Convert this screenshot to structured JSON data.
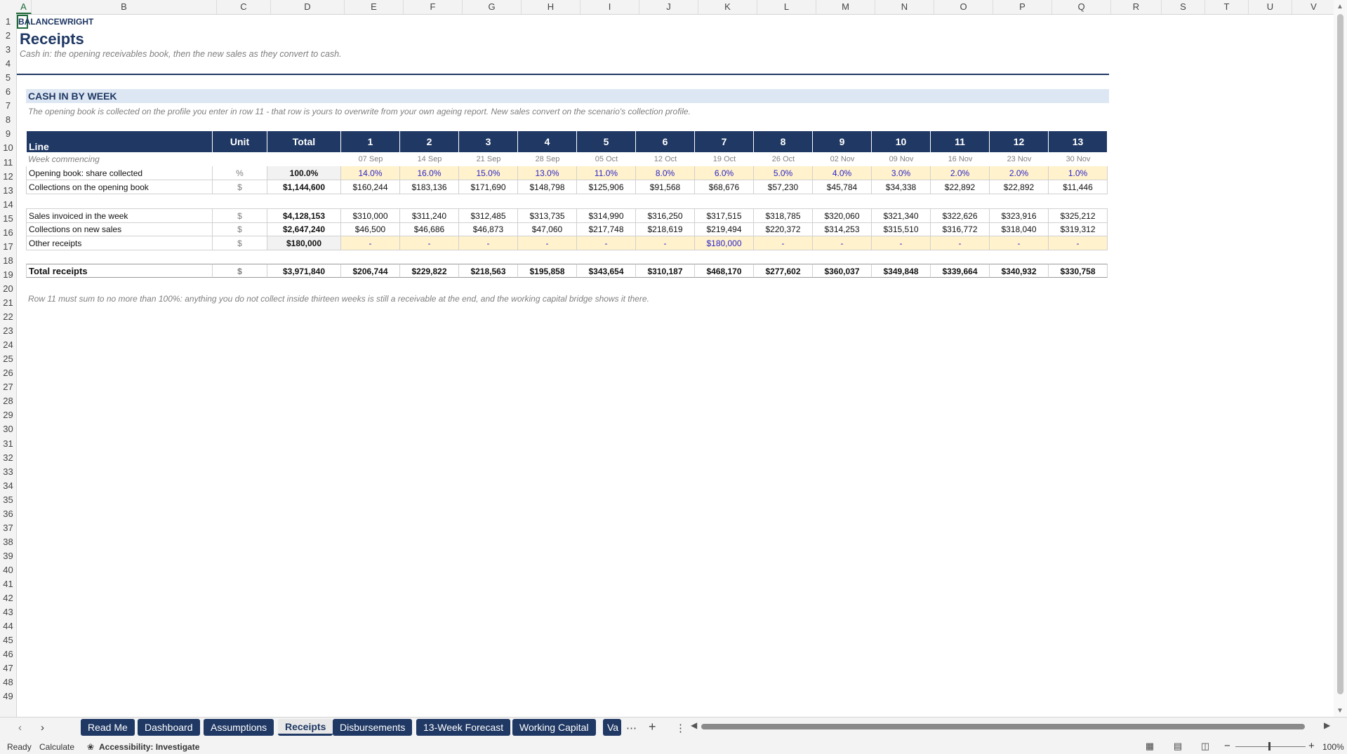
{
  "columns": [
    "A",
    "B",
    "C",
    "D",
    "E",
    "F",
    "G",
    "H",
    "I",
    "J",
    "K",
    "L",
    "M",
    "N",
    "O",
    "P",
    "Q",
    "R",
    "S",
    "T",
    "U",
    "V"
  ],
  "rows": [
    "1",
    "2",
    "3",
    "4",
    "5",
    "6",
    "7",
    "8",
    "9",
    "10",
    "11",
    "12",
    "13",
    "14",
    "15",
    "16",
    "17",
    "18",
    "19",
    "20",
    "21",
    "22",
    "23",
    "24",
    "25",
    "26",
    "27",
    "28",
    "29",
    "30",
    "31",
    "32",
    "33",
    "34",
    "35",
    "36",
    "37",
    "38",
    "39",
    "40",
    "41",
    "42",
    "43",
    "44",
    "45",
    "46",
    "47",
    "48",
    "49"
  ],
  "brand": "BALANCEWRIGHT",
  "title": "Receipts",
  "subtitle": "Cash in: the opening receivables book, then the new sales as they convert to cash.",
  "section_title": "CASH IN BY WEEK",
  "note": "The opening book is collected on the profile you enter in row 11 - that row is yours to overwrite from your own ageing report. New sales convert on the scenario's collection profile.",
  "table": {
    "header": {
      "line": "Line",
      "unit": "Unit",
      "total": "Total",
      "weeks": [
        "1",
        "2",
        "3",
        "4",
        "5",
        "6",
        "7",
        "8",
        "9",
        "10",
        "11",
        "12",
        "13"
      ]
    },
    "week_commencing": {
      "label": "Week commencing",
      "dates": [
        "07 Sep",
        "14 Sep",
        "21 Sep",
        "28 Sep",
        "05 Oct",
        "12 Oct",
        "19 Oct",
        "26 Oct",
        "02 Nov",
        "09 Nov",
        "16 Nov",
        "23 Nov",
        "30 Nov"
      ]
    },
    "opening_share": {
      "label": "Opening book: share collected",
      "unit": "%",
      "total": "100.0%",
      "values": [
        "14.0%",
        "16.0%",
        "15.0%",
        "13.0%",
        "11.0%",
        "8.0%",
        "6.0%",
        "5.0%",
        "4.0%",
        "3.0%",
        "2.0%",
        "2.0%",
        "1.0%"
      ]
    },
    "opening_collections": {
      "label": "Collections on the opening book",
      "unit": "$",
      "total": "$1,144,600",
      "values": [
        "$160,244",
        "$183,136",
        "$171,690",
        "$148,798",
        "$125,906",
        "$91,568",
        "$68,676",
        "$57,230",
        "$45,784",
        "$34,338",
        "$22,892",
        "$22,892",
        "$11,446"
      ]
    },
    "sales_invoiced": {
      "label": "Sales invoiced in the week",
      "unit": "$",
      "total": "$4,128,153",
      "values": [
        "$310,000",
        "$311,240",
        "$312,485",
        "$313,735",
        "$314,990",
        "$316,250",
        "$317,515",
        "$318,785",
        "$320,060",
        "$321,340",
        "$322,626",
        "$323,916",
        "$325,212"
      ]
    },
    "new_collections": {
      "label": "Collections on new sales",
      "unit": "$",
      "total": "$2,647,240",
      "values": [
        "$46,500",
        "$46,686",
        "$46,873",
        "$47,060",
        "$217,748",
        "$218,619",
        "$219,494",
        "$220,372",
        "$314,253",
        "$315,510",
        "$316,772",
        "$318,040",
        "$319,312"
      ]
    },
    "other_receipts": {
      "label": "Other receipts",
      "unit": "$",
      "total": "$180,000",
      "values": [
        "-",
        "-",
        "-",
        "-",
        "-",
        "-",
        "$180,000",
        "-",
        "-",
        "-",
        "-",
        "-",
        "-"
      ]
    },
    "total_receipts": {
      "label": "Total receipts",
      "unit": "$",
      "total": "$3,971,840",
      "values": [
        "$206,744",
        "$229,822",
        "$218,563",
        "$195,858",
        "$343,654",
        "$310,187",
        "$468,170",
        "$277,602",
        "$360,037",
        "$349,848",
        "$339,664",
        "$340,932",
        "$330,758"
      ]
    }
  },
  "footer_note": "Row 11 must sum to no more than 100%: anything you do not collect inside thirteen weeks is still a receivable at the end, and the working capital bridge shows it there.",
  "tabs": [
    {
      "label": "Read Me"
    },
    {
      "label": "Dashboard"
    },
    {
      "label": "Assumptions"
    },
    {
      "label": "Receipts"
    },
    {
      "label": "Disbursements"
    },
    {
      "label": "13-Week Forecast"
    },
    {
      "label": "Working Capital"
    },
    {
      "label": "Va"
    }
  ],
  "status": {
    "ready": "Ready",
    "calculate": "Calculate",
    "accessibility": "Accessibility: Investigate",
    "zoom": "100%"
  },
  "icons": {
    "tab_prev": "chevron-left-icon",
    "tab_next": "chevron-right-icon",
    "more_tabs": "ellipsis-icon",
    "add_sheet": "plus-icon",
    "options": "vertical-ellipsis-icon",
    "accessibility": "accessibility-icon"
  },
  "colors": {
    "navy": "#1f3864",
    "input_fill": "#fff2cc",
    "input_text": "#2b24c9",
    "section_fill": "#dde7f3",
    "selection": "#1d6b3a"
  }
}
